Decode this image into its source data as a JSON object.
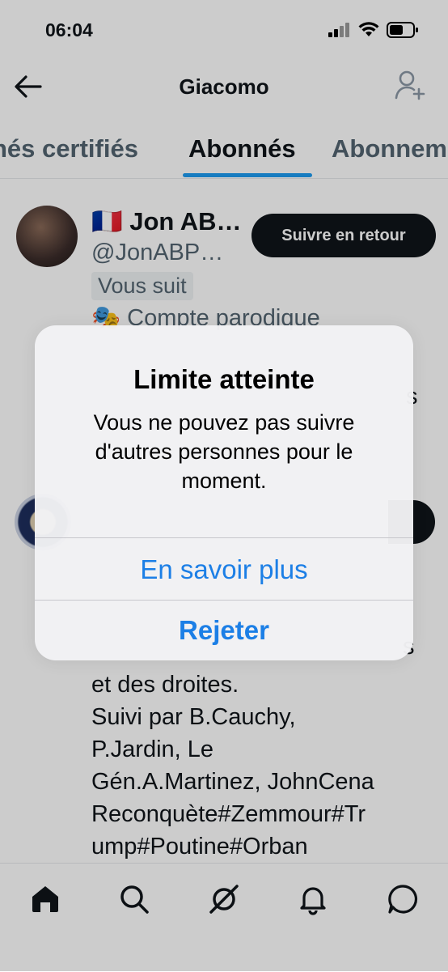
{
  "status_bar": {
    "time": "06:04"
  },
  "header": {
    "title": "Giacomo"
  },
  "tabs": [
    {
      "label": "nés certifiés"
    },
    {
      "label": "Abonnés",
      "active": true
    },
    {
      "label": "Abonnem"
    }
  ],
  "followers": [
    {
      "name": "🇫🇷 Jon AB…",
      "handle": "@JonABP…",
      "follows_you": "Vous suit",
      "parody": "🎭 Compte parodique",
      "button": "Suivre en retour"
    },
    {
      "bio": "et des droites.\nSuivi par B.Cauchy,\nP.Jardin, Le\nGén.A.Martinez, JohnCena\nReconquète#Zemmour#Tr\nump#Poutine#Orban"
    }
  ],
  "alert": {
    "title": "Limite atteinte",
    "message": "Vous ne pouvez pas suivre d'autres personnes pour le moment.",
    "learn_more": "En savoir plus",
    "dismiss": "Rejeter"
  },
  "colors": {
    "accent": "#1d9bf0",
    "alert_button": "#1c7fe6",
    "text": "#0f1419",
    "secondary": "#536471"
  },
  "bottom_nav": [
    "home-icon",
    "search-icon",
    "grok-icon",
    "notifications-icon",
    "messages-icon"
  ]
}
